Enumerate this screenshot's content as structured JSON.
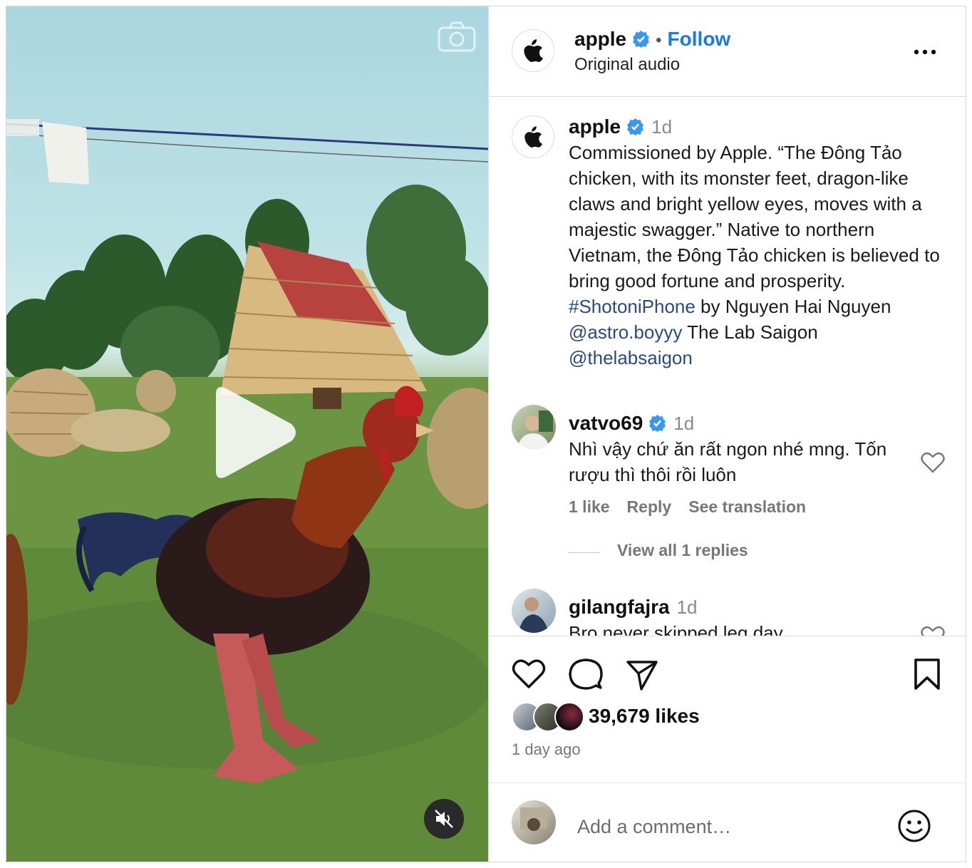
{
  "header": {
    "username": "apple",
    "follow_label": "Follow",
    "separator": "•",
    "audio_label": "Original audio"
  },
  "caption": {
    "username": "apple",
    "time": "1d",
    "text_intro": "Commissioned by Apple. “The Đông Tảo chicken, with its monster feet, dragon-like claws and bright yellow eyes, moves with a majestic swagger.” Native to northern Vietnam, the Đông Tảo chicken is believed to bring good fortune and prosperity. ",
    "hashtag": "#ShotoniPhone",
    "text_by": " by Nguyen Hai Nguyen ",
    "mention1": "@astro.boyyy",
    "text_lab": " The Lab Saigon ",
    "mention2": "@thelabsaigon"
  },
  "comments": [
    {
      "username": "vatvo69",
      "time": "1d",
      "text": "Nhì vậy chứ ăn rất ngon nhé mng. Tốn rượu thì thôi rồi luôn",
      "likes": "1 like",
      "reply": "Reply",
      "translate": "See translation",
      "view_replies": "View all 1 replies"
    },
    {
      "username": "gilangfajra",
      "time": "1d",
      "text": "Bro never skipped leg day.."
    }
  ],
  "stats": {
    "likes": "39,679 likes",
    "posted": "1 day ago"
  },
  "comment_box": {
    "placeholder": "Add a comment…"
  },
  "icons": [
    "camera-icon",
    "play-icon",
    "mute-icon",
    "verified-icon",
    "more-icon",
    "heart-icon",
    "comment-icon",
    "share-icon",
    "bookmark-icon",
    "emoji-icon"
  ],
  "colors": {
    "accent": "#1877f2",
    "link": "#284a8a",
    "verified": "#3897f0"
  }
}
